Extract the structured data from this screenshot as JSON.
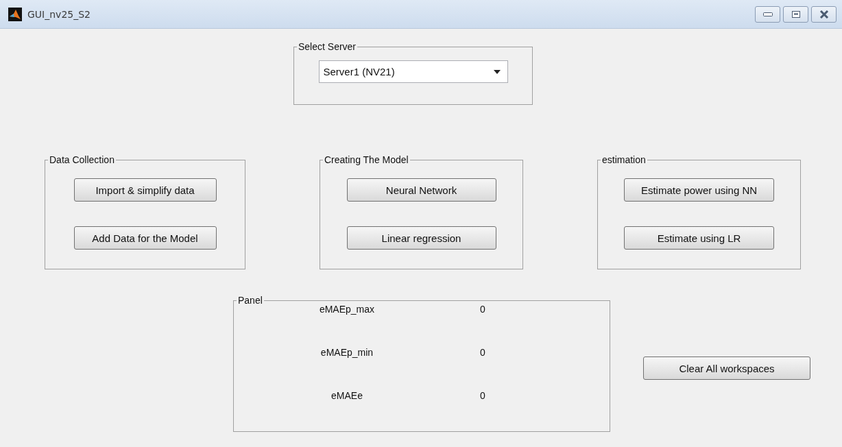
{
  "window": {
    "title": "GUI_nv25_S2"
  },
  "server_panel": {
    "title": "Select Server",
    "dropdown": {
      "value": "Server1 (NV21)"
    }
  },
  "panels": [
    {
      "title": "Data Collection",
      "buttons": [
        "Import & simplify data",
        "Add Data for the Model"
      ]
    },
    {
      "title": "Creating The Model",
      "buttons": [
        "Neural Network",
        "Linear regression"
      ]
    },
    {
      "title": "estimation",
      "buttons": [
        "Estimate power using NN",
        "Estimate using LR"
      ]
    }
  ],
  "results_panel": {
    "title": "Panel",
    "rows": [
      {
        "label": "eMAEp_max",
        "value": "0"
      },
      {
        "label": "eMAEp_min",
        "value": "0"
      },
      {
        "label": "eMAEe",
        "value": "0"
      }
    ]
  },
  "buttons": [
    "Clear All workspaces"
  ]
}
